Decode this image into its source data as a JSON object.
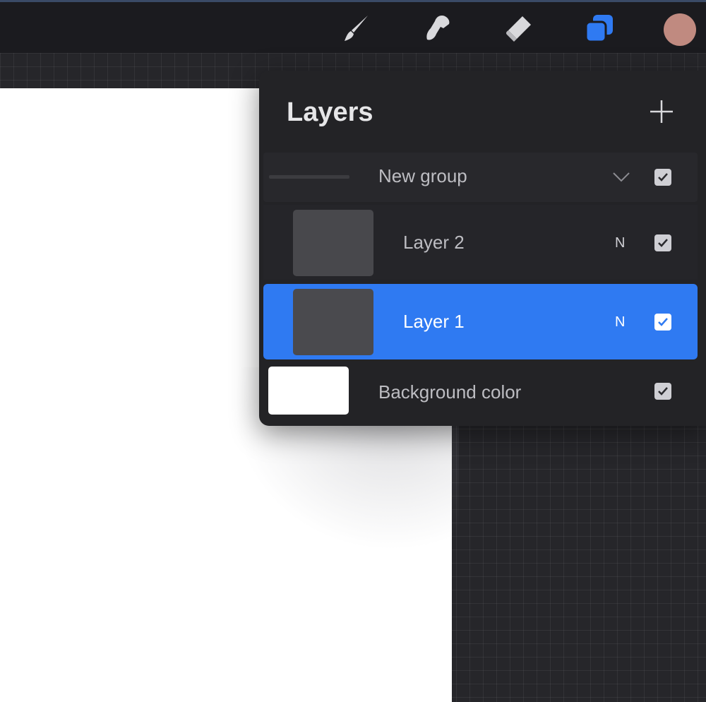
{
  "toolbar": {
    "tools": [
      {
        "name": "brush-icon"
      },
      {
        "name": "smudge-icon"
      },
      {
        "name": "eraser-icon"
      },
      {
        "name": "layers-icon",
        "active": true
      }
    ],
    "current_color": "#c08a80"
  },
  "layers_panel": {
    "title": "Layers",
    "add_icon": "plus-icon",
    "rows": {
      "group": {
        "label": "New group",
        "expanded": true,
        "visible": true
      },
      "layer2": {
        "label": "Layer 2",
        "blend": "N",
        "visible": true
      },
      "layer1": {
        "label": "Layer 1",
        "blend": "N",
        "visible": true,
        "selected": true
      },
      "background": {
        "label": "Background color",
        "visible": true,
        "color": "#ffffff"
      }
    }
  },
  "colors": {
    "accent": "#2f7af2",
    "panel": "#232326",
    "toolbar": "#1b1b1f"
  }
}
